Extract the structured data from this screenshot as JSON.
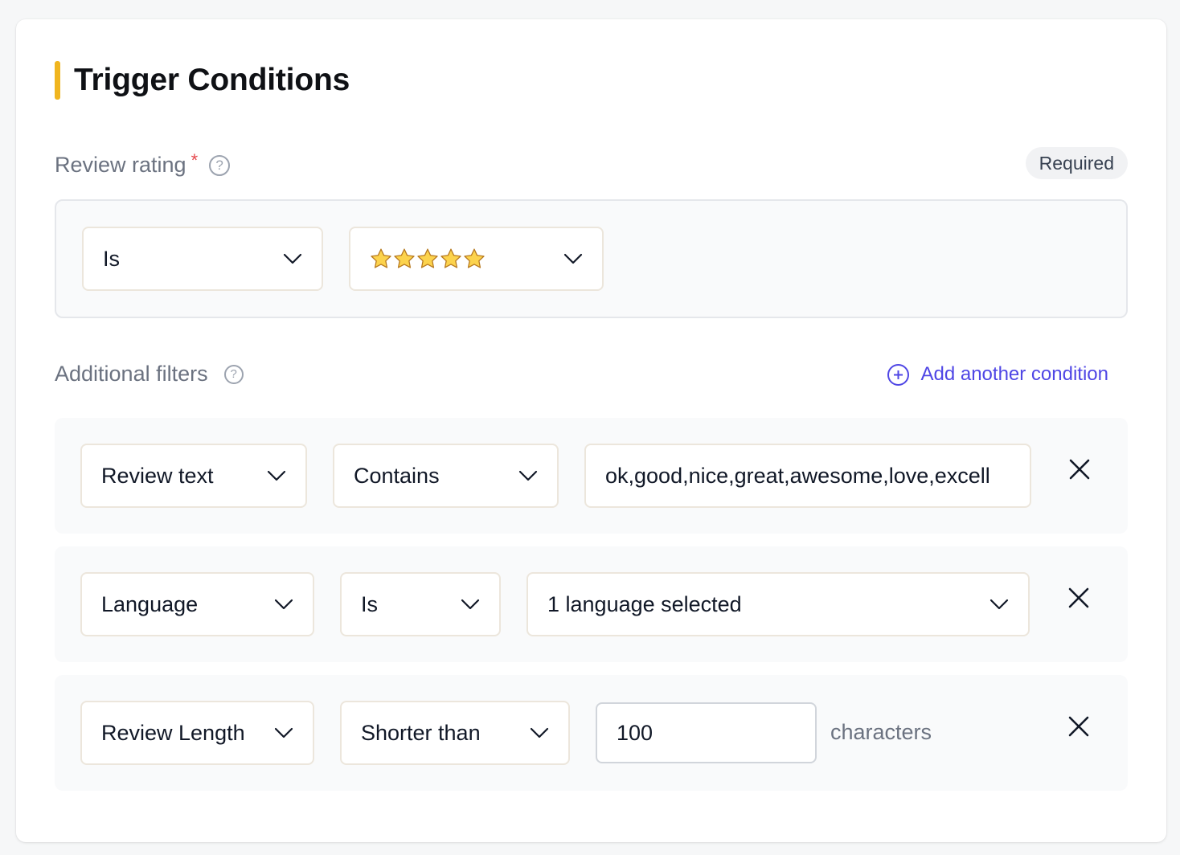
{
  "title": "Trigger Conditions",
  "review_rating": {
    "label": "Review rating",
    "required_mark": "*",
    "help": "?",
    "badge": "Required",
    "operator": "Is",
    "value_stars": 5
  },
  "additional": {
    "label": "Additional filters",
    "help": "?",
    "add_label": "Add another condition"
  },
  "filters": [
    {
      "field": "Review text",
      "operator": "Contains",
      "value": "ok,good,nice,great,awesome,love,excell"
    },
    {
      "field": "Language",
      "operator": "Is",
      "value": "1 language selected"
    },
    {
      "field": "Review Length",
      "operator": "Shorter than",
      "value": "100",
      "suffix": "characters"
    }
  ],
  "colors": {
    "accent": "#f0b51f",
    "link": "#4f46e5",
    "required_star": "#e5484d",
    "star_fill": "#fcd34d"
  },
  "icons": [
    "help-icon",
    "chevron-down-icon",
    "star-icon",
    "plus-circle-icon",
    "close-icon"
  ]
}
